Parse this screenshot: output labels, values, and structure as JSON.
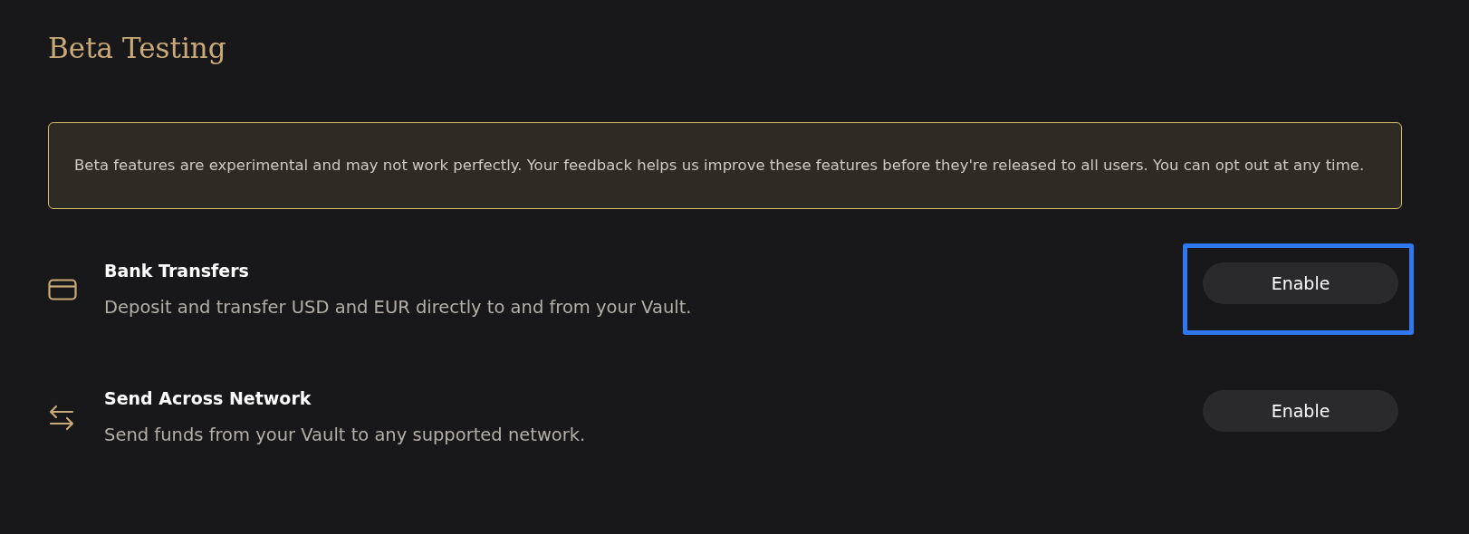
{
  "page": {
    "title": "Beta Testing"
  },
  "notice": {
    "text": "Beta features are experimental and may not work perfectly. Your feedback helps us improve these features before they're released to all users. You can opt out at any time."
  },
  "features": [
    {
      "kind": "card",
      "name": "Bank Transfers",
      "description": "Deposit and transfer USD and EUR directly to and from your Vault.",
      "button": "Enable",
      "highlighted": true
    },
    {
      "kind": "transfer",
      "name": "Send Across Network",
      "description": "Send funds from your Vault to any supported network.",
      "button": "Enable",
      "highlighted": false
    }
  ]
}
